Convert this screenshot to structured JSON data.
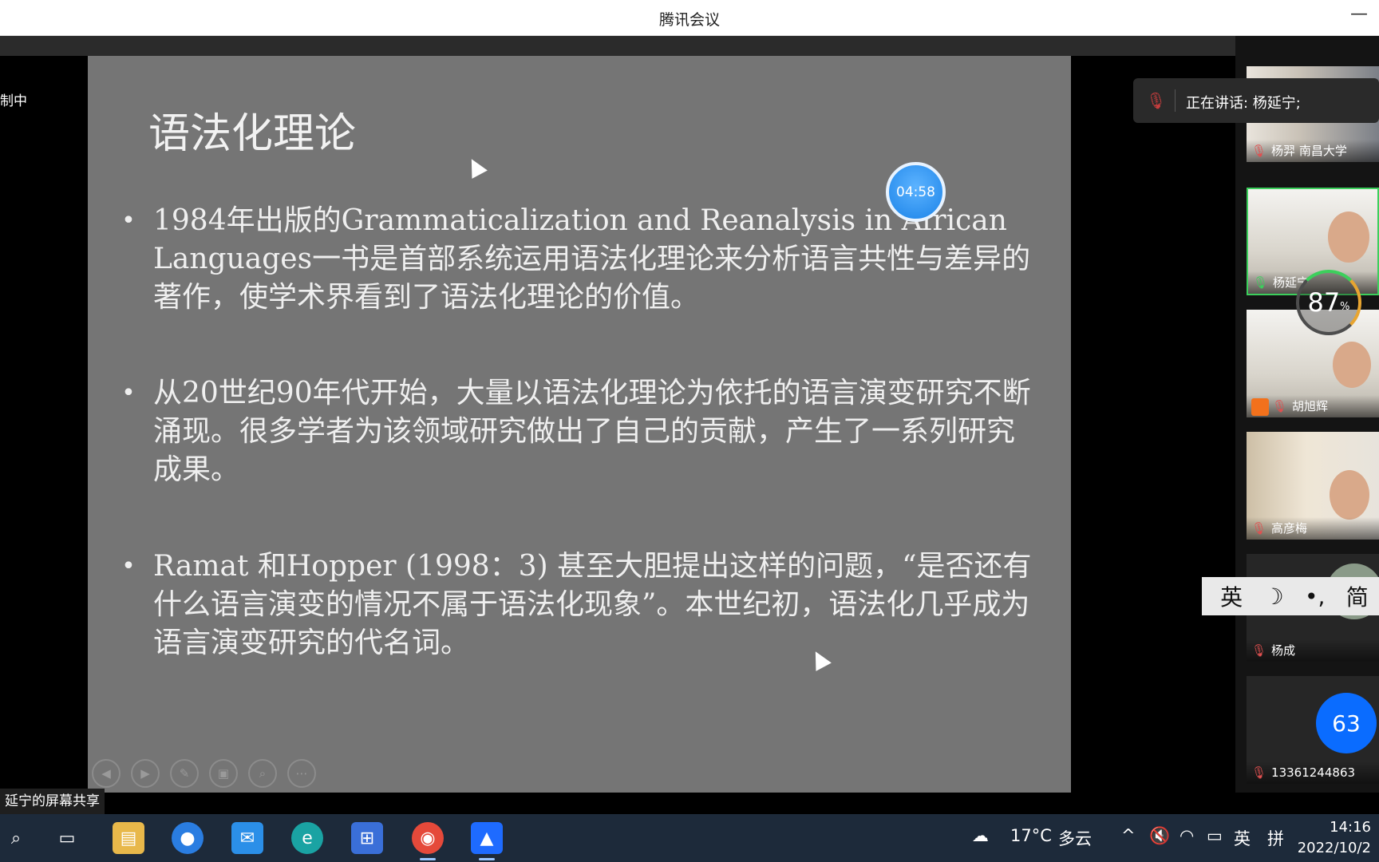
{
  "window": {
    "title": "腾讯会议",
    "minimize": "—"
  },
  "left_label": "制中",
  "share_label": "延宁的屏幕共享",
  "slide": {
    "title": "语法化理论",
    "bullets": [
      "1984年出版的Grammaticalization and Reanalysis in African Languages一书是首部系统运用语法化理论来分析语言共性与差异的著作，使学术界看到了语法化理论的价值。",
      "从20世纪90年代开始，大量以语法化理论为依托的语言演变研究不断涌现。很多学者为该领域研究做出了自己的贡献，产生了一系列研究成果。",
      "Ramat 和Hopper (1998：3) 甚至大胆提出这样的问题，“是否还有什么语言演变的情况不属于语法化现象”。本世纪初，语法化几乎成为语言演变研究的代名词。"
    ],
    "bullet_glyph": "•",
    "timer": "04:58",
    "controls": [
      "prev-icon",
      "next-icon",
      "pen-icon",
      "layout-icon",
      "zoom-icon",
      "more-icon"
    ]
  },
  "speaking": {
    "label": "正在讲话: 杨延宁;"
  },
  "participants": [
    {
      "name": "杨羿 南昌大学",
      "mic": "muted"
    },
    {
      "name": "杨延宁",
      "mic": "active"
    },
    {
      "name": "胡旭辉",
      "mic": "muted"
    },
    {
      "name": "高彦梅",
      "mic": "muted"
    },
    {
      "name": "杨成",
      "mic": "muted"
    },
    {
      "name": "13361244863",
      "mic": "muted"
    }
  ],
  "participant_count": "63",
  "network": {
    "value": "87",
    "unit": "%"
  },
  "ime": {
    "items": [
      "英",
      "☽",
      "•,",
      "简"
    ]
  },
  "taskbar": {
    "weather": {
      "temp": "17°C",
      "desc": "多云"
    },
    "ime_lang": "英",
    "ime_mode": "拼",
    "time": "14:16",
    "date": "2022/10/2"
  },
  "colors": {
    "slide_bg": "#757575",
    "accent": "#0a6cff",
    "active_border": "#3ccf5c"
  }
}
